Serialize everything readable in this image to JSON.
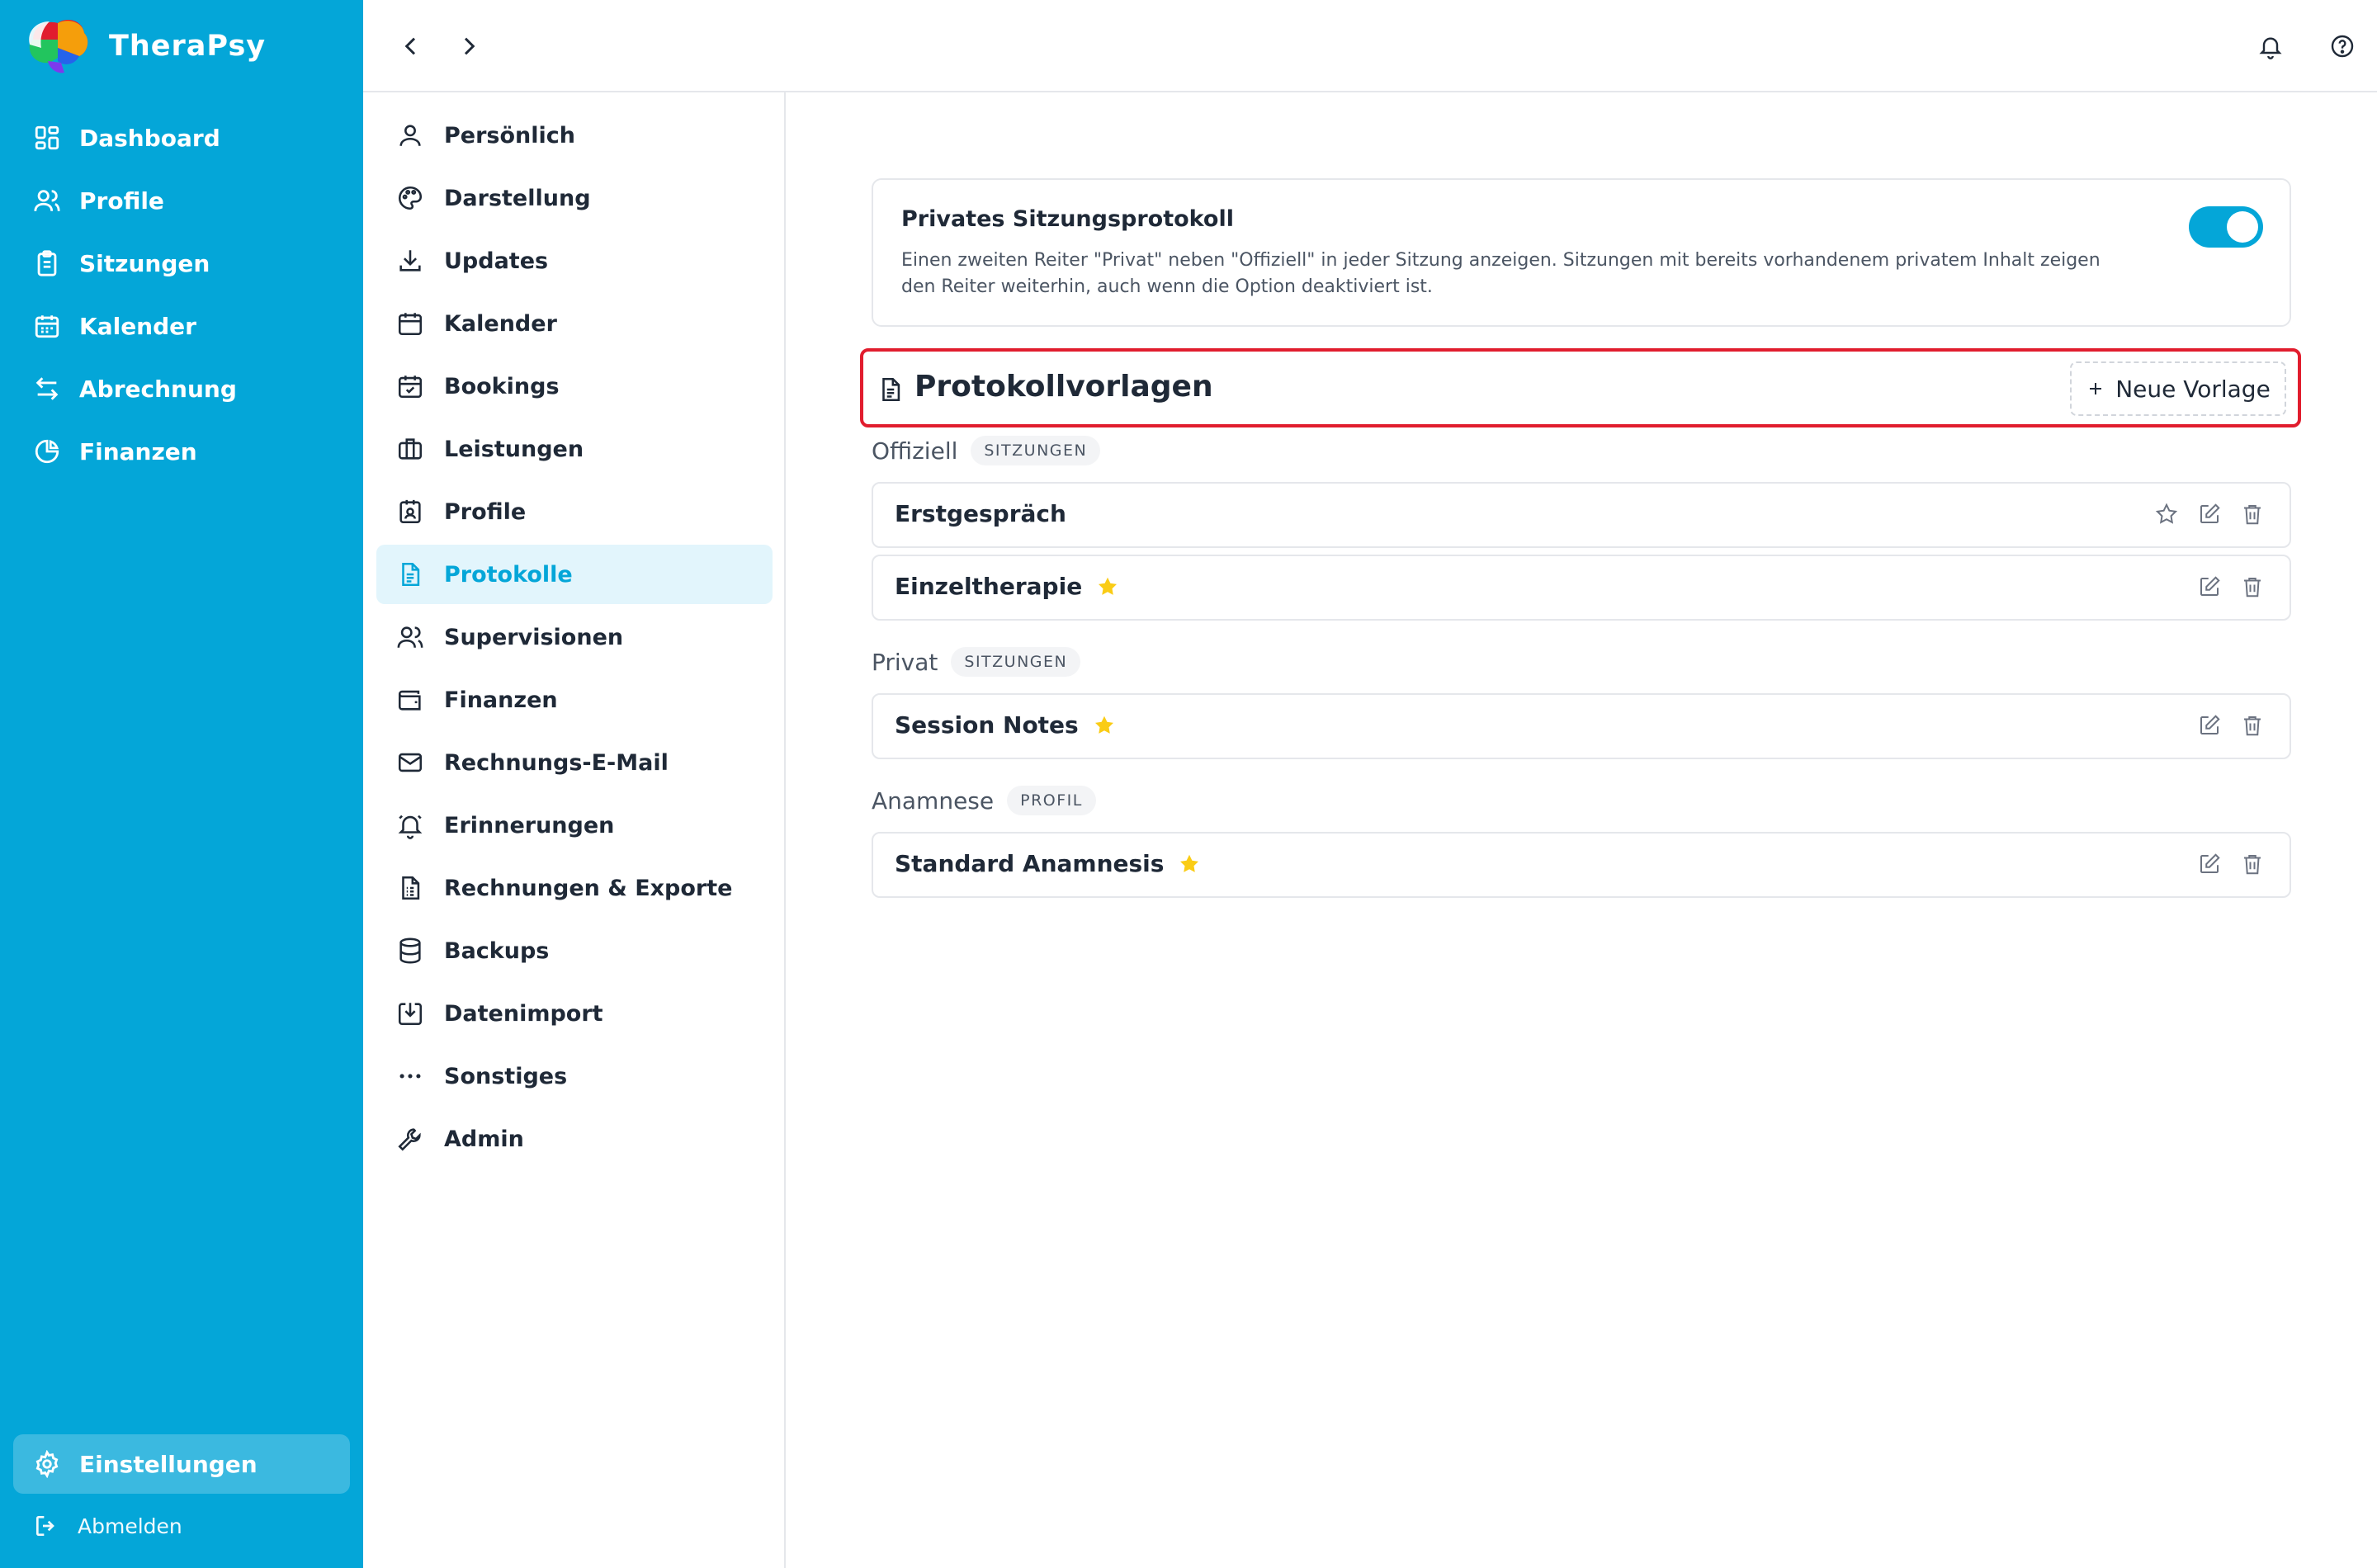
{
  "app": {
    "name": "TheraPsy",
    "brand_colors": {
      "primary": "#04a6d8",
      "highlight": "#e11d2e",
      "star": "#facc15"
    }
  },
  "sidebar": {
    "items": [
      {
        "label": "Dashboard",
        "icon": "dashboard-icon"
      },
      {
        "label": "Profile",
        "icon": "users-icon"
      },
      {
        "label": "Sitzungen",
        "icon": "clipboard-icon"
      },
      {
        "label": "Kalender",
        "icon": "calendar-icon"
      },
      {
        "label": "Abrechnung",
        "icon": "arrows-icon"
      },
      {
        "label": "Finanzen",
        "icon": "pie-chart-icon"
      }
    ],
    "settings_label": "Einstellungen",
    "logout_label": "Abmelden"
  },
  "topbar": {
    "back_icon": "chevron-left-icon",
    "forward_icon": "chevron-right-icon",
    "notifications_icon": "bell-icon",
    "help_icon": "help-circle-icon"
  },
  "settings_menu": {
    "active": "Protokolle",
    "items": [
      {
        "label": "Persönlich",
        "icon": "user-icon"
      },
      {
        "label": "Darstellung",
        "icon": "palette-icon"
      },
      {
        "label": "Updates",
        "icon": "download-icon"
      },
      {
        "label": "Kalender",
        "icon": "calendar-icon"
      },
      {
        "label": "Bookings",
        "icon": "calendar-check-icon"
      },
      {
        "label": "Leistungen",
        "icon": "briefcase-icon"
      },
      {
        "label": "Profile",
        "icon": "contact-icon"
      },
      {
        "label": "Protokolle",
        "icon": "document-icon"
      },
      {
        "label": "Supervisionen",
        "icon": "users-icon"
      },
      {
        "label": "Finanzen",
        "icon": "wallet-icon"
      },
      {
        "label": "Rechnungs-E-Mail",
        "icon": "mail-icon"
      },
      {
        "label": "Erinnerungen",
        "icon": "bell-ring-icon"
      },
      {
        "label": "Rechnungen & Exporte",
        "icon": "receipt-icon"
      },
      {
        "label": "Backups",
        "icon": "database-icon"
      },
      {
        "label": "Datenimport",
        "icon": "import-icon"
      },
      {
        "label": "Sonstiges",
        "icon": "more-icon"
      },
      {
        "label": "Admin",
        "icon": "wrench-icon"
      }
    ]
  },
  "main": {
    "private_card": {
      "title": "Privates Sitzungsprotokoll",
      "description": "Einen zweiten Reiter \"Privat\" neben \"Offiziell\" in jeder Sitzung anzeigen. Sitzungen mit bereits vorhandenem privatem Inhalt zeigen den Reiter weiterhin, auch wenn die Option deaktiviert ist.",
      "enabled": true
    },
    "templates": {
      "title": "Protokollvorlagen",
      "new_button": "Neue Vorlage",
      "groups": [
        {
          "label": "Offiziell",
          "tag": "SITZUNGEN",
          "items": [
            {
              "name": "Erstgespräch",
              "favorite": false
            },
            {
              "name": "Einzeltherapie",
              "favorite": true
            }
          ]
        },
        {
          "label": "Privat",
          "tag": "SITZUNGEN",
          "items": [
            {
              "name": "Session Notes",
              "favorite": true
            }
          ]
        },
        {
          "label": "Anamnese",
          "tag": "PROFIL",
          "items": [
            {
              "name": "Standard Anamnesis",
              "favorite": true
            }
          ]
        }
      ]
    }
  }
}
